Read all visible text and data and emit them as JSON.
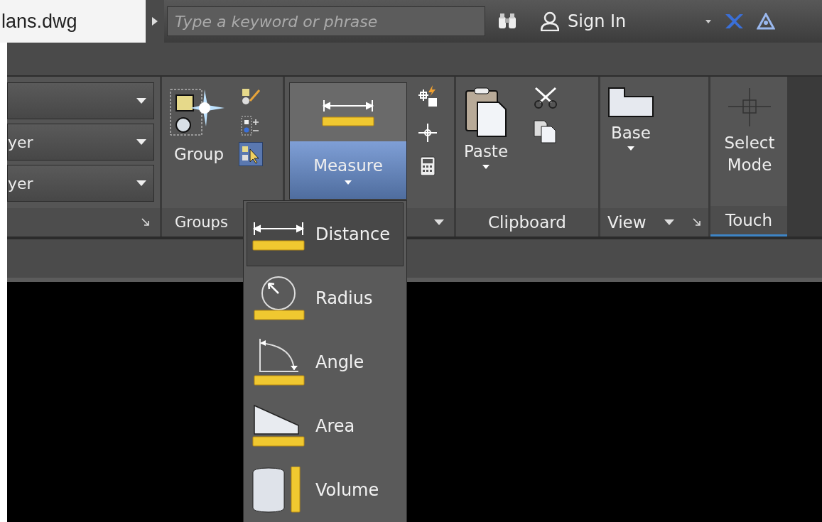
{
  "title_bar": {
    "file_name": "lans.dwg",
    "search": {
      "placeholder": "Type a keyword or phrase"
    },
    "sign_in": "Sign In"
  },
  "ribbon": {
    "layers": {
      "dropdowns": [
        {
          "kind": "blank"
        },
        {
          "kind": "text",
          "value": "yer"
        },
        {
          "kind": "text",
          "value": "yer"
        }
      ]
    },
    "groups": {
      "button": "Group",
      "label": "Groups",
      "small_buttons": [
        {
          "kind": "edit",
          "on": false
        },
        {
          "kind": "add",
          "on": false
        },
        {
          "kind": "select",
          "on": true
        }
      ]
    },
    "utilities": {
      "button": "Measure",
      "open": true
    },
    "clipboard": {
      "button": "Paste",
      "label": "Clipboard"
    },
    "view": {
      "button": "Base",
      "label": "View"
    },
    "touch": {
      "button": "Select Mode",
      "label": "Touch"
    }
  },
  "measure_menu": {
    "items": [
      {
        "kind": "distance",
        "label": "Distance",
        "selected": true
      },
      {
        "kind": "radius",
        "label": "Radius",
        "selected": false
      },
      {
        "kind": "angle",
        "label": "Angle",
        "selected": false
      },
      {
        "kind": "area",
        "label": "Area",
        "selected": false
      },
      {
        "kind": "volume",
        "label": "Volume",
        "selected": false
      }
    ]
  }
}
